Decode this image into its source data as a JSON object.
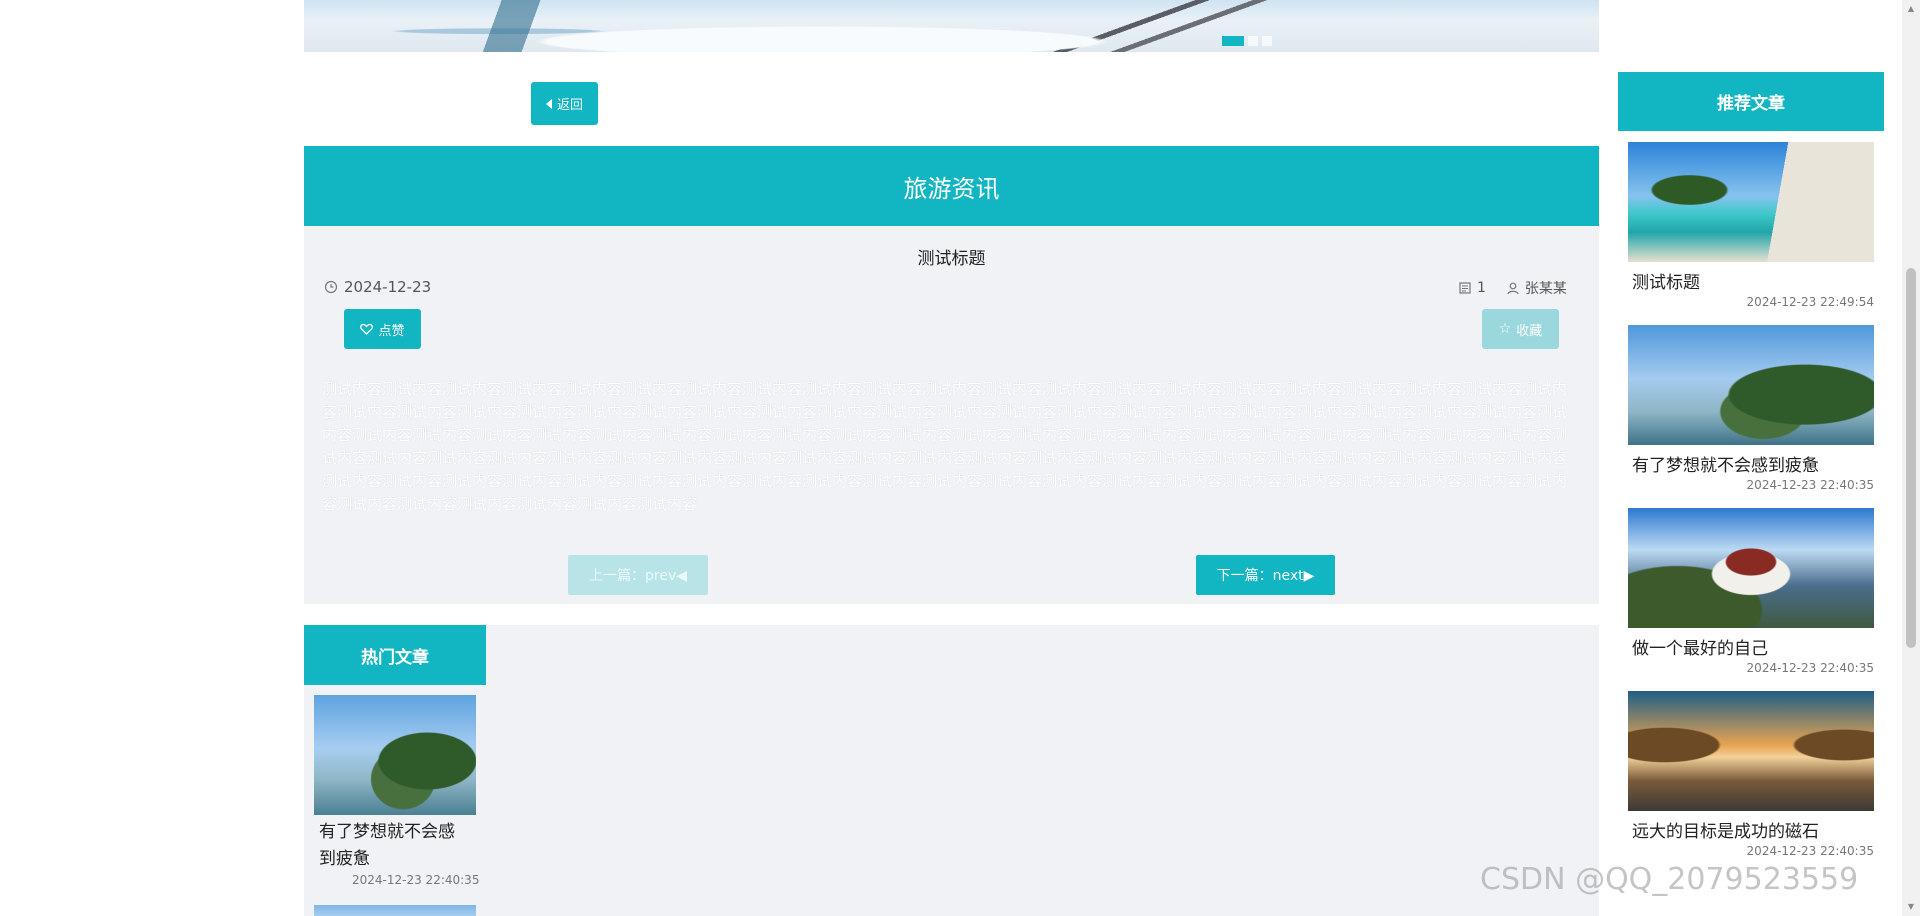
{
  "back_button": {
    "label": "返回"
  },
  "section_title": "旅游资讯",
  "article": {
    "title": "测试标题",
    "date": "2024-12-23",
    "views": "1",
    "author": "张某某",
    "like_label": "点赞",
    "favorite_label": "收藏",
    "content": "测试内容测试内容测试内容测试内容测试内容测试内容测试内容测试内容测试内容测试内容测试内容测试内容测试内容测试内容测试内容测试内容测试内容测试内容测试内容测试内容测试内容测试内容测试内容测试内容测试内容测试内容测试内容测试内容测试内容测试内容测试内容测试内容测试内容测试内容测试内容测试内容测试内容测试内容测试内容测试内容测试内容测试内容测试内容测试内容测试内容测试内容测试内容测试内容测试内容测试内容测试内容测试内容测试内容测试内容测试内容测试内容测试内容测试内容测试内容测试内容测试内容测试内容测试内容测试内容测试内容测试内容测试内容测试内容测试内容测试内容测试内容测试内容测试内容测试内容测试内容测试内容测试内容测试内容测试内容测试内容测试内容测试内容测试内容测试内容测试内容测试内容测试内容测试内容测试内容测试内容测试内容测试内容测试内容测试内容测试内容测试内容测试内容测试内容测试内容测试内容测试内容测试内容测试内容测试内容测试内容测试内容测试内容测试内容测试内容测试内容",
    "prev_label": "上一篇：prev◀",
    "next_label": "下一篇：next▶"
  },
  "hot": {
    "title": "热门文章",
    "items": [
      {
        "title": "有了梦想就不会感到疲惫",
        "time": "2024-12-23 22:40:35"
      }
    ]
  },
  "recommended": {
    "title": "推荐文章",
    "items": [
      {
        "title": "测试标题",
        "time": "2024-12-23 22:49:54"
      },
      {
        "title": "有了梦想就不会感到疲惫",
        "time": "2024-12-23 22:40:35"
      },
      {
        "title": "做一个最好的自己",
        "time": "2024-12-23 22:40:35"
      },
      {
        "title": "远大的目标是成功的磁石",
        "time": "2024-12-23 22:40:35"
      }
    ]
  },
  "watermark": "CSDN @QQ_2079523559",
  "colors": {
    "accent": "#12b6c3",
    "accent_disabled": "#9ad8de",
    "panel_bg": "#f1f2f6"
  }
}
